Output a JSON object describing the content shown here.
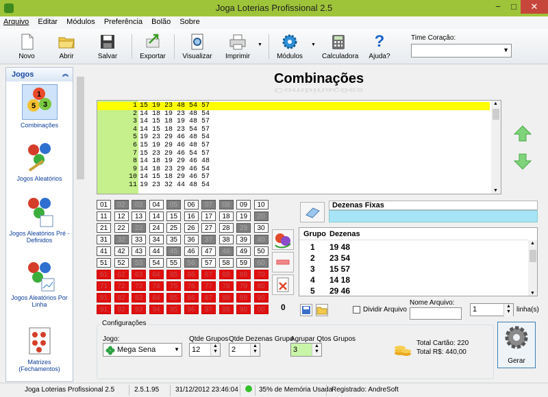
{
  "window": {
    "title": "Joga Loterias Profissional 2.5",
    "minimize": "−",
    "maximize": "□",
    "close": "✕"
  },
  "menu": [
    "Arquivo",
    "Editar",
    "Módulos",
    "Preferência",
    "Bolão",
    "Sobre"
  ],
  "toolbar": {
    "novo": "Novo",
    "abrir": "Abrir",
    "salvar": "Salvar",
    "exportar": "Exportar",
    "visualizar": "Visualizar",
    "imprimir": "Imprimir",
    "modulos": "Módulos",
    "calculadora": "Calculadora",
    "ajuda": "Ajuda?",
    "time_label": "Time Coração:",
    "time_value": ""
  },
  "sidebar": {
    "header": "Jogos",
    "items": [
      "Combinações",
      "Jogos Aleatórios",
      "Jogos Aleatórios Pré - Definidos",
      "Jogos Aleatórios Por Linha",
      "Matrizes (Fechamentos)"
    ]
  },
  "main": {
    "heading": "Combinações",
    "combos": [
      {
        "n": "1",
        "v": "15 19 23 48 54 57"
      },
      {
        "n": "2",
        "v": "14 18 19 23 48 54"
      },
      {
        "n": "3",
        "v": "14 15 18 19 48 57"
      },
      {
        "n": "4",
        "v": "14 15 18 23 54 57"
      },
      {
        "n": "5",
        "v": "19 23 29 46 48 54"
      },
      {
        "n": "6",
        "v": "15 19 29 46 48 57"
      },
      {
        "n": "7",
        "v": "15 23 29 46 54 57"
      },
      {
        "n": "8",
        "v": "14 18 19 29 46 48"
      },
      {
        "n": "9",
        "v": "14 18 23 29 46 54"
      },
      {
        "n": "10",
        "v": "14 15 18 29 46 57"
      },
      {
        "n": "11",
        "v": "19 23 32 44 48 54"
      }
    ],
    "selected_count": "0",
    "dezenas_fixas_label": "Dezenas Fixas",
    "dezenas_fixas_value": "",
    "group_headers": [
      "Grupo",
      "Dezenas"
    ],
    "groups": [
      {
        "g": "1",
        "d": "19 48"
      },
      {
        "g": "2",
        "d": "23 54"
      },
      {
        "g": "3",
        "d": "15 57"
      },
      {
        "g": "4",
        "d": "14 18"
      },
      {
        "g": "5",
        "d": "29 46"
      }
    ],
    "dividir_label": "Dividir Arquivo",
    "nome_arquivo_label": "Nome Arquivo:",
    "nome_arquivo_value": "",
    "linhas_value": "1",
    "linhas_label": "linha(s)"
  },
  "numbers": {
    "white": [
      "01",
      "04",
      "06",
      "09",
      "10",
      "11",
      "12",
      "13",
      "14",
      "15",
      "16",
      "17",
      "18",
      "19",
      "21",
      "22",
      "24",
      "25",
      "26",
      "27",
      "28",
      "30",
      "31",
      "33",
      "34",
      "35",
      "36",
      "38",
      "39",
      "41",
      "42",
      "43",
      "44",
      "46",
      "47",
      "49",
      "50",
      "51",
      "52",
      "54",
      "55",
      "57",
      "58",
      "59"
    ],
    "gray": [
      "02",
      "03",
      "05",
      "07",
      "08",
      "20",
      "23",
      "29",
      "32",
      "37",
      "40",
      "45",
      "48",
      "53",
      "56",
      "60"
    ]
  },
  "config": {
    "label": "Configurações",
    "jogo_label": "Jogo:",
    "jogo_value": "Mega Sena",
    "qtde_grupos_label": "Qtde Grupos",
    "qtde_grupos_value": "12",
    "qtde_dezenas_label": "Qtde Dezenas Grupo",
    "qtde_dezenas_value": "2",
    "agrupar_label": "Agrupar Qtos Grupos",
    "agrupar_value": "3",
    "total_cartao": "Total Cartão: 220",
    "total_rs": "Total R$: 440,00",
    "gerar": "Gerar"
  },
  "status": {
    "app": "Joga Loterias Profissional 2.5",
    "version": "2.5.1.95",
    "datetime": "31/12/2012 23:46:04",
    "memory": "35% de Memória Usada",
    "registered": "Registrado: AndreSoft"
  },
  "colors": {
    "titlebar": "#9ec43a",
    "selected_row": "#ffff00",
    "gutter": "#c6f08c",
    "dezenas_fixas": "#a8e4f7",
    "red_cells": "#e01010"
  }
}
